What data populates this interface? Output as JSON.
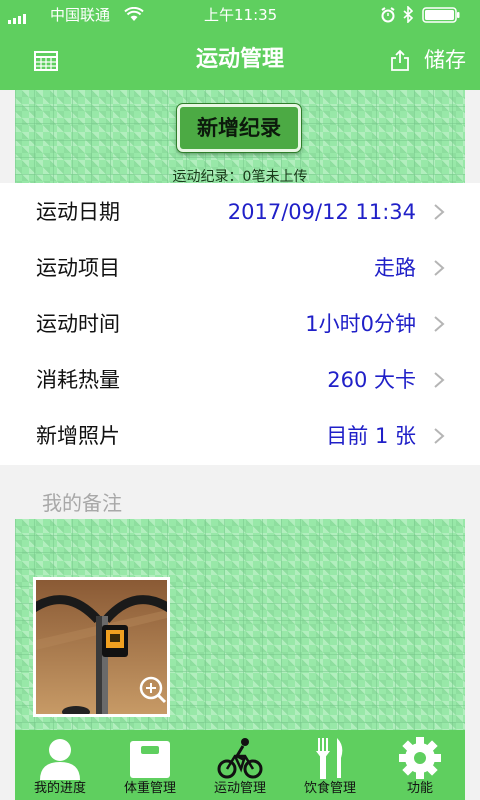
{
  "status_bar": {
    "carrier": "中国联通",
    "time": "上午11:35"
  },
  "nav": {
    "title": "运动管理",
    "save_label": "储存",
    "left_icon": "calendar-icon",
    "share_icon": "share-icon"
  },
  "banner": {
    "add_record_label": "新增纪录",
    "upload_status": "运动纪录：0笔未上传"
  },
  "form": {
    "rows": [
      {
        "label": "运动日期",
        "value": "2017/09/12 11:34"
      },
      {
        "label": "运动项目",
        "value": "走路"
      },
      {
        "label": "运动时间",
        "value": "1小时0分钟"
      },
      {
        "label": "消耗热量",
        "value": "260 大卡"
      },
      {
        "label": "新增照片",
        "value": "目前 1 张"
      }
    ]
  },
  "notes": {
    "placeholder": "我的备注"
  },
  "tabs": [
    {
      "label": "我的进度",
      "icon": "person-icon"
    },
    {
      "label": "体重管理",
      "icon": "scale-icon"
    },
    {
      "label": "运动管理",
      "icon": "bicycle-icon"
    },
    {
      "label": "饮食管理",
      "icon": "fork-knife-icon"
    },
    {
      "label": "功能",
      "icon": "gear-icon"
    }
  ],
  "colors": {
    "primary_green": "#5fcf5f",
    "value_blue": "#2020c8",
    "texture_green": "#98e8a8"
  }
}
